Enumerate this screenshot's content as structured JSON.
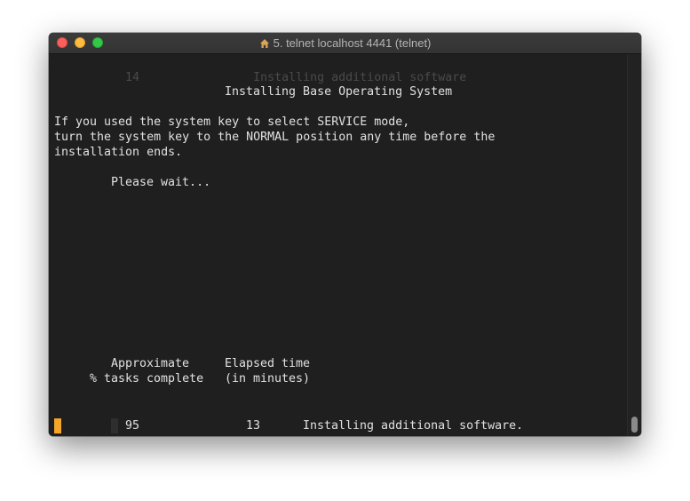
{
  "window": {
    "title": "5. telnet localhost 4441 (telnet)",
    "title_icon": "home-icon"
  },
  "terminal": {
    "ghost_top": "14                Installing additional software",
    "heading": "Installing Base Operating System",
    "message_line_1": "If you used the system key to select SERVICE mode,",
    "message_line_2": "turn the system key to the NORMAL position any time before the",
    "message_line_3": "installation ends.",
    "wait_text": "Please wait...",
    "col1_header_1": "Approximate",
    "col1_header_2": "% tasks complete",
    "col2_header_1": "Elapsed time",
    "col2_header_2": "(in minutes)",
    "percent_complete": "95",
    "elapsed_minutes": "13",
    "status_text": "Installing additional software."
  },
  "colors": {
    "background": "#1f1f1f",
    "text": "#e1e1e1",
    "cursor": "#f4a52a"
  }
}
